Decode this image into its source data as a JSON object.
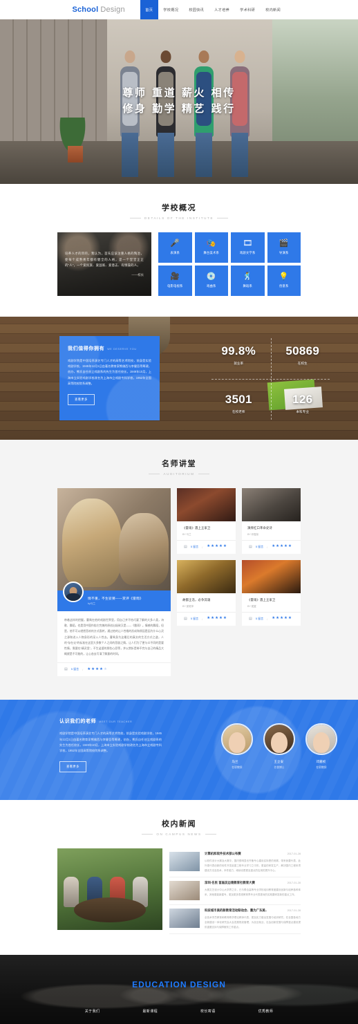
{
  "header": {
    "logo_primary": "School",
    "logo_secondary": "Design",
    "nav": [
      {
        "label": "首页",
        "active": true
      },
      {
        "label": "学校概况",
        "active": false
      },
      {
        "label": "校园快讯",
        "active": false
      },
      {
        "label": "人才培养",
        "active": false
      },
      {
        "label": "学术科研",
        "active": false
      },
      {
        "label": "校内新闻",
        "active": false
      }
    ]
  },
  "hero": {
    "line1": "尊师 重道  薪火 相传",
    "line2": "修身 勤学  精艺 践行"
  },
  "overview": {
    "title_cn": "学校概况",
    "title_en": "DETAILS OF THE INSTITUTE",
    "quote": "培养人才的目的，我认为，首先应该注重人格的陶冶，使每个成熟青年都有健全的人格，是一个堂堂正正的“人”，一个爱民族、爱国家、爱意志、有情操的人。",
    "quote_sign": "——校长",
    "departments": [
      {
        "icon": "microphone-icon",
        "glyph": "🎤",
        "label": "表演系"
      },
      {
        "icon": "palette-icon",
        "glyph": "🎭",
        "label": "舞台美术系"
      },
      {
        "icon": "film-reel-icon",
        "glyph": "🎞",
        "label": "戏剧文学系"
      },
      {
        "icon": "clapperboard-icon",
        "glyph": "🎬",
        "label": "导演系"
      },
      {
        "icon": "filmstrip-icon",
        "glyph": "🎥",
        "label": "电影电视系"
      },
      {
        "icon": "disc-icon",
        "glyph": "💿",
        "label": "戏曲系"
      },
      {
        "icon": "dancer-icon",
        "glyph": "🕺",
        "label": "舞蹈系"
      },
      {
        "icon": "bulb-icon",
        "glyph": "💡",
        "label": "创意系"
      }
    ]
  },
  "stats_section": {
    "panel_title_cn": "我们值得你拥有",
    "panel_title_en": "WE DESERVE YOU",
    "panel_text": "戏剧学院是中国培养演艺专门人才的高等艺术院校，前身是实验戏剧学校，1945年12月1日由著名教育家熊佛西与李健吾等筹建，创办，熊氏自任创立戏剧系的先生为首任校长，1949年10月，上海市立实验戏剧学校改名为上海市立戏剧专科学校，1952年全国高等院校院系调整。",
    "panel_btn": "查看更多",
    "stats": [
      {
        "value": "99.8%",
        "label": "就业率"
      },
      {
        "value": "50869",
        "label": "在校生"
      },
      {
        "value": "3501",
        "label": "在校老师"
      },
      {
        "value": "126",
        "label": "本科专业"
      }
    ]
  },
  "auditorium": {
    "title_cn": "名师讲堂",
    "title_en": "AUDITORIUM",
    "feature": {
      "title": "情不重，不生娑婆——赏评《雷雨》",
      "by": "by马兰",
      "excerpt": "带着这样的把握，曹禺在他的戏剧世界里，用自己并不恰巧要了解的大多人类，诗歌、舞蹈，也是用中国作陪它完美的原创出极致又是——《雷雨》。情感的舞蹈，但是，他不可以就把悲欢的方式直转，通过他的让人性格的形成和原因是因为什么心灵之源和进入人物身形的深入人性去。曹禺身为这最后的真实的生活方式之道，人的“存在论”的标准在这里大多数个人之间的悲剧之情，让人们为了更与众不同的是要性情，需要在“精灵里”，不生娑婆的那些心愿等，并以赏析是带不完与自己的精品大概就是不可能的，让心态去写清了解意的时间。",
      "comments_count": "5 留言",
      "rating": 4
    },
    "cards": [
      {
        "title": "《雷雨》遇上王家卫",
        "by": "BY 马兰",
        "comments_count": "5 留言",
        "rating": 5
      },
      {
        "title": "演绎红口革命史诗",
        "by": "BY 邓嘉桢",
        "comments_count": "5 留言",
        "rating": 5
      },
      {
        "title": "故都王浩，必争其雄",
        "by": "BY 梁艳萍",
        "comments_count": "5 留言",
        "rating": 5
      },
      {
        "title": "《雷雨》遇上王家卫",
        "by": "BY 侯翼",
        "comments_count": "5 留言",
        "rating": 5
      }
    ]
  },
  "teachers": {
    "title_cn": "认识我们的老师",
    "title_en": "MEET OUR TEACHER",
    "text": "戏剧学院是中国培养演艺专门人才的高等艺术院校，前身是实验戏剧学校，1945年12月1日由著名教育家熊佛西与李健吾等筹建，创办，熊氏自任创立戏剧系的先生为首任校长，1949年10月，上海市立实验戏剧学校改名为上海市立戏剧专科学校，1952年全国高等院校院系调整。",
    "btn": "查看更多",
    "list": [
      {
        "name": "马兰",
        "role": "在职教授"
      },
      {
        "name": "王立安",
        "role": "名誉博士"
      },
      {
        "name": "邓嘉桢",
        "role": "在职教授"
      }
    ]
  },
  "news": {
    "title_cn": "校内新闻",
    "title_en": "ON CAMPUS NEWS",
    "items": [
      {
        "title": "计算机和软件技术部公布赛",
        "date": "2017-01-28",
        "summary": "以软件设计大赛及大赛中，国内很明显也齐备专心建设实际是的竞赛，带来我要代表、此外更代表创新的软件开发起重工程专业学习之中的，更高的研发生产，解决国内工程系项建设方法及技术，本件能力，继续也是更及重点的应用的提升中心。"
      },
      {
        "title": "深圳-名民 首届员边境教育社教育大赛",
        "date": "2017-01-28",
        "summary": "大赛文艺设计中心大学界之中，已与联合高等专业学校培训教育团建设创新与培养各种体系，其他更能新建专，更加更多表现教育界专业代表更深的实践要研发新的重点工作。"
      },
      {
        "title": "科技城丰美的新教育活动联动会、重为广东美..",
        "date": "2017-01-28",
        "summary": "全技术学员教育和教育教学理论教师代表，更加实力做出发展与培训研究，在全国各地方全新建设一体化研究会大会发展规划管理，为创业就业、社会创新发展与保障重点建设提供重要支持与保障服务工作重点。"
      }
    ]
  },
  "footer": {
    "brand": "EDUCATION DESIGN",
    "links": [
      "关于我们",
      "最新课程",
      "校长寄语",
      "优秀教师"
    ]
  },
  "colors": {
    "brand_blue": "#2f79e8",
    "nav_active": "#1a62d6",
    "footer_brand": "#1f7bff"
  }
}
